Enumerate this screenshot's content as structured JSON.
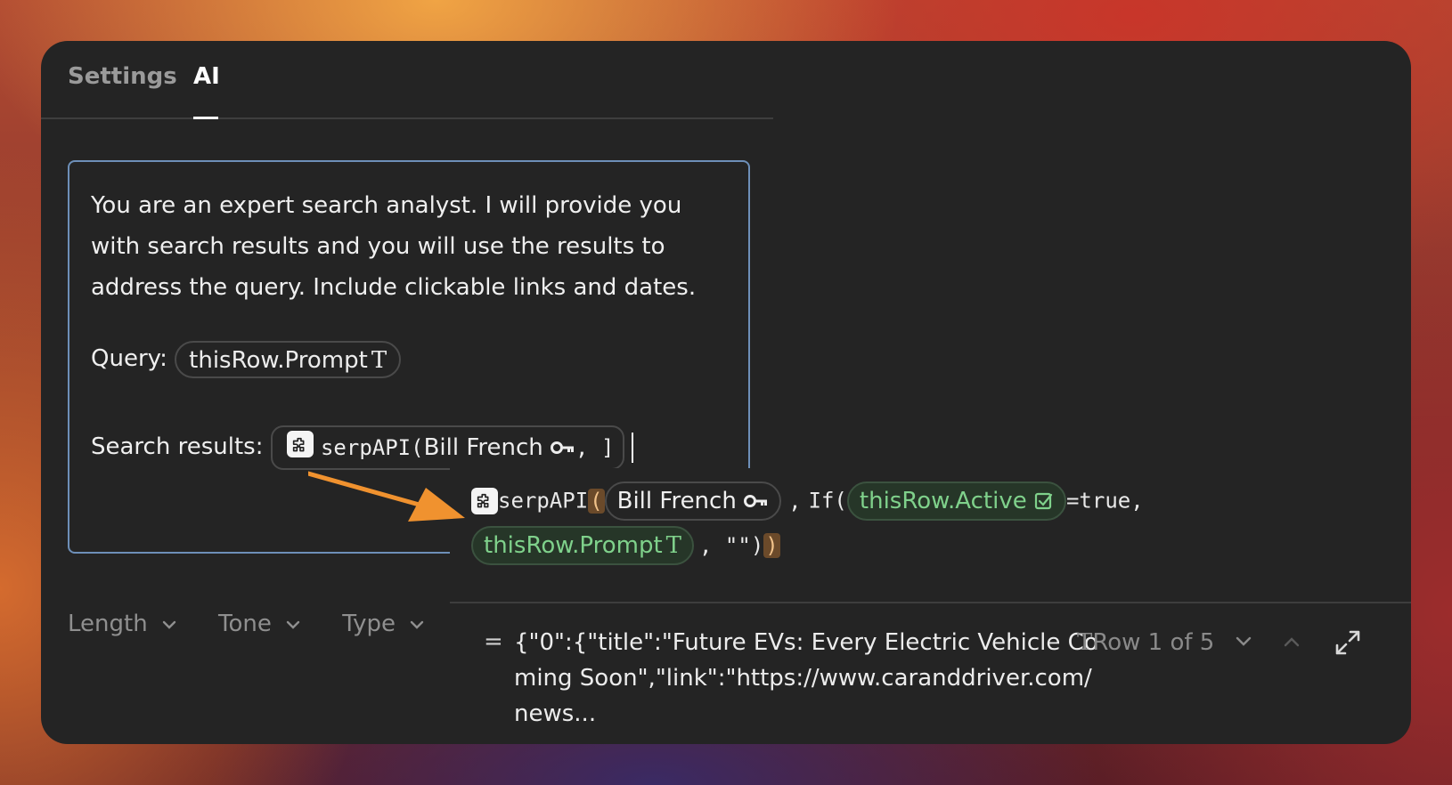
{
  "tabs": [
    {
      "label": "Settings",
      "active": false
    },
    {
      "label": "AI",
      "active": true
    }
  ],
  "prompt": {
    "text": "You are an expert search analyst. I will provide you with search results and you will use the results to address the query. Include clickable links and dates.",
    "query_label": "Query:",
    "query_pill": {
      "label": "thisRow.Prompt",
      "type_glyph": "T"
    },
    "results_label": "Search results:",
    "results_pill": {
      "icon": "puzzle-icon",
      "func": "serpAPI(",
      "arg": "Bill French",
      "key_icon": "key-icon",
      "tail": ", ]"
    }
  },
  "formula": {
    "func": "serpAPI",
    "open_paren": "(",
    "account_pill": {
      "label": "Bill French",
      "icon": "key-icon"
    },
    "sep1": ",",
    "if_text": "If(",
    "active_pill": {
      "label": "thisRow.Active",
      "icon": "checkbox-icon"
    },
    "equals_true": "=true,",
    "prompt_pill": {
      "label": "thisRow.Prompt",
      "type_glyph": "T"
    },
    "tail": ", \"\")",
    "close_paren": ")"
  },
  "result": {
    "equals": "=",
    "text": "{\"0\":{\"title\":\"Future EVs: Every Electric Vehicle Coming Soon\",\"link\":\"https://www.caranddriver.com/news...",
    "type_glyph": "T",
    "row_indicator": "Row 1 of 5"
  },
  "controls": {
    "length_label": "Length",
    "tone_label": "Tone",
    "type_label": "Type"
  },
  "colors": {
    "panel_bg": "#242424",
    "box_border": "#6d8fb8",
    "green_text": "#7fd18b",
    "paren_highlight": "#6b4a2a",
    "arrow": "#f0922f"
  }
}
